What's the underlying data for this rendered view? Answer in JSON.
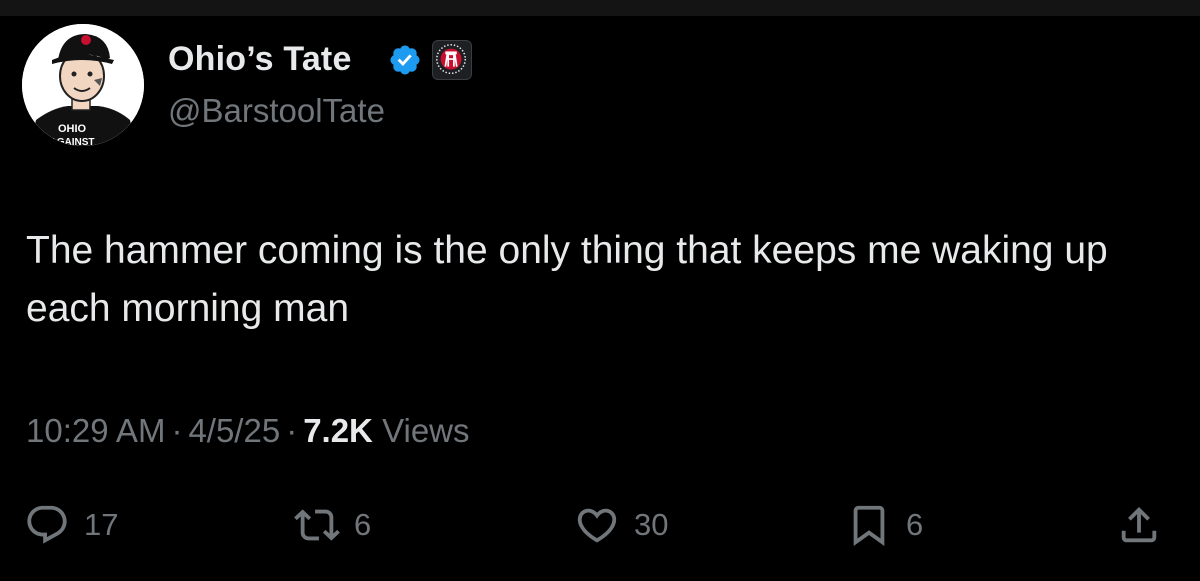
{
  "tweet": {
    "display_name": "Ohio’s Tate",
    "handle": "@BarstoolTate",
    "text": "The hammer coming is the only thing that keeps me waking up each morning man",
    "time": "10:29 AM",
    "date": "4/5/25",
    "views_count": "7.2K",
    "views_label": "Views",
    "separator": "·",
    "avatar_shirt_text": "OHIO",
    "avatar_shirt_text_2": "AGAINST"
  },
  "actions": {
    "replies": "17",
    "retweets": "6",
    "likes": "30",
    "bookmarks": "6"
  },
  "colors": {
    "background": "#000000",
    "text_primary": "#e7e9ea",
    "text_secondary": "#71767b",
    "verified": "#1d9bf0"
  },
  "icons": [
    "verified-badge-icon",
    "barstool-affiliate-icon",
    "reply-icon",
    "retweet-icon",
    "like-icon",
    "bookmark-icon",
    "share-icon"
  ]
}
